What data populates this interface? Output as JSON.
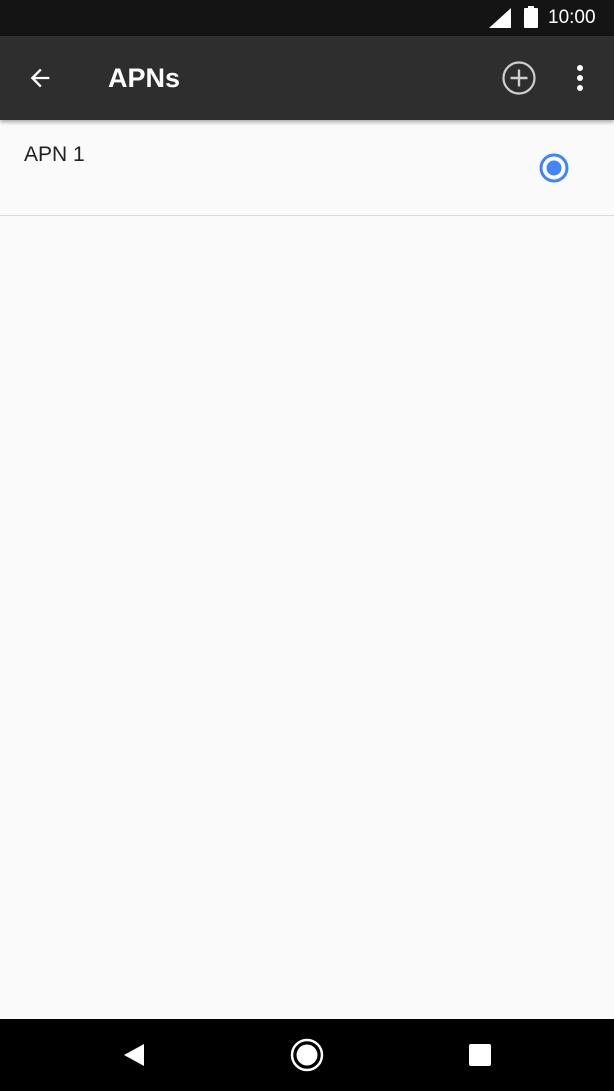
{
  "status_bar": {
    "time": "10:00",
    "icons": [
      "cell-signal-icon",
      "battery-icon"
    ]
  },
  "app_bar": {
    "title": "APNs",
    "icons": [
      "back-arrow-icon",
      "add-circle-icon",
      "more-vert-icon"
    ]
  },
  "apn_list": {
    "items": [
      {
        "label": "APN 1",
        "selected": true
      }
    ]
  },
  "nav_bar": {
    "icons": [
      "back-triangle-icon",
      "home-circle-icon",
      "recents-square-icon"
    ]
  },
  "colors": {
    "status_bar": "#141414",
    "app_bar": "#2e2e2e",
    "background": "#fafafa",
    "radio_accent": "#4285f4",
    "nav_bar": "#000000"
  }
}
